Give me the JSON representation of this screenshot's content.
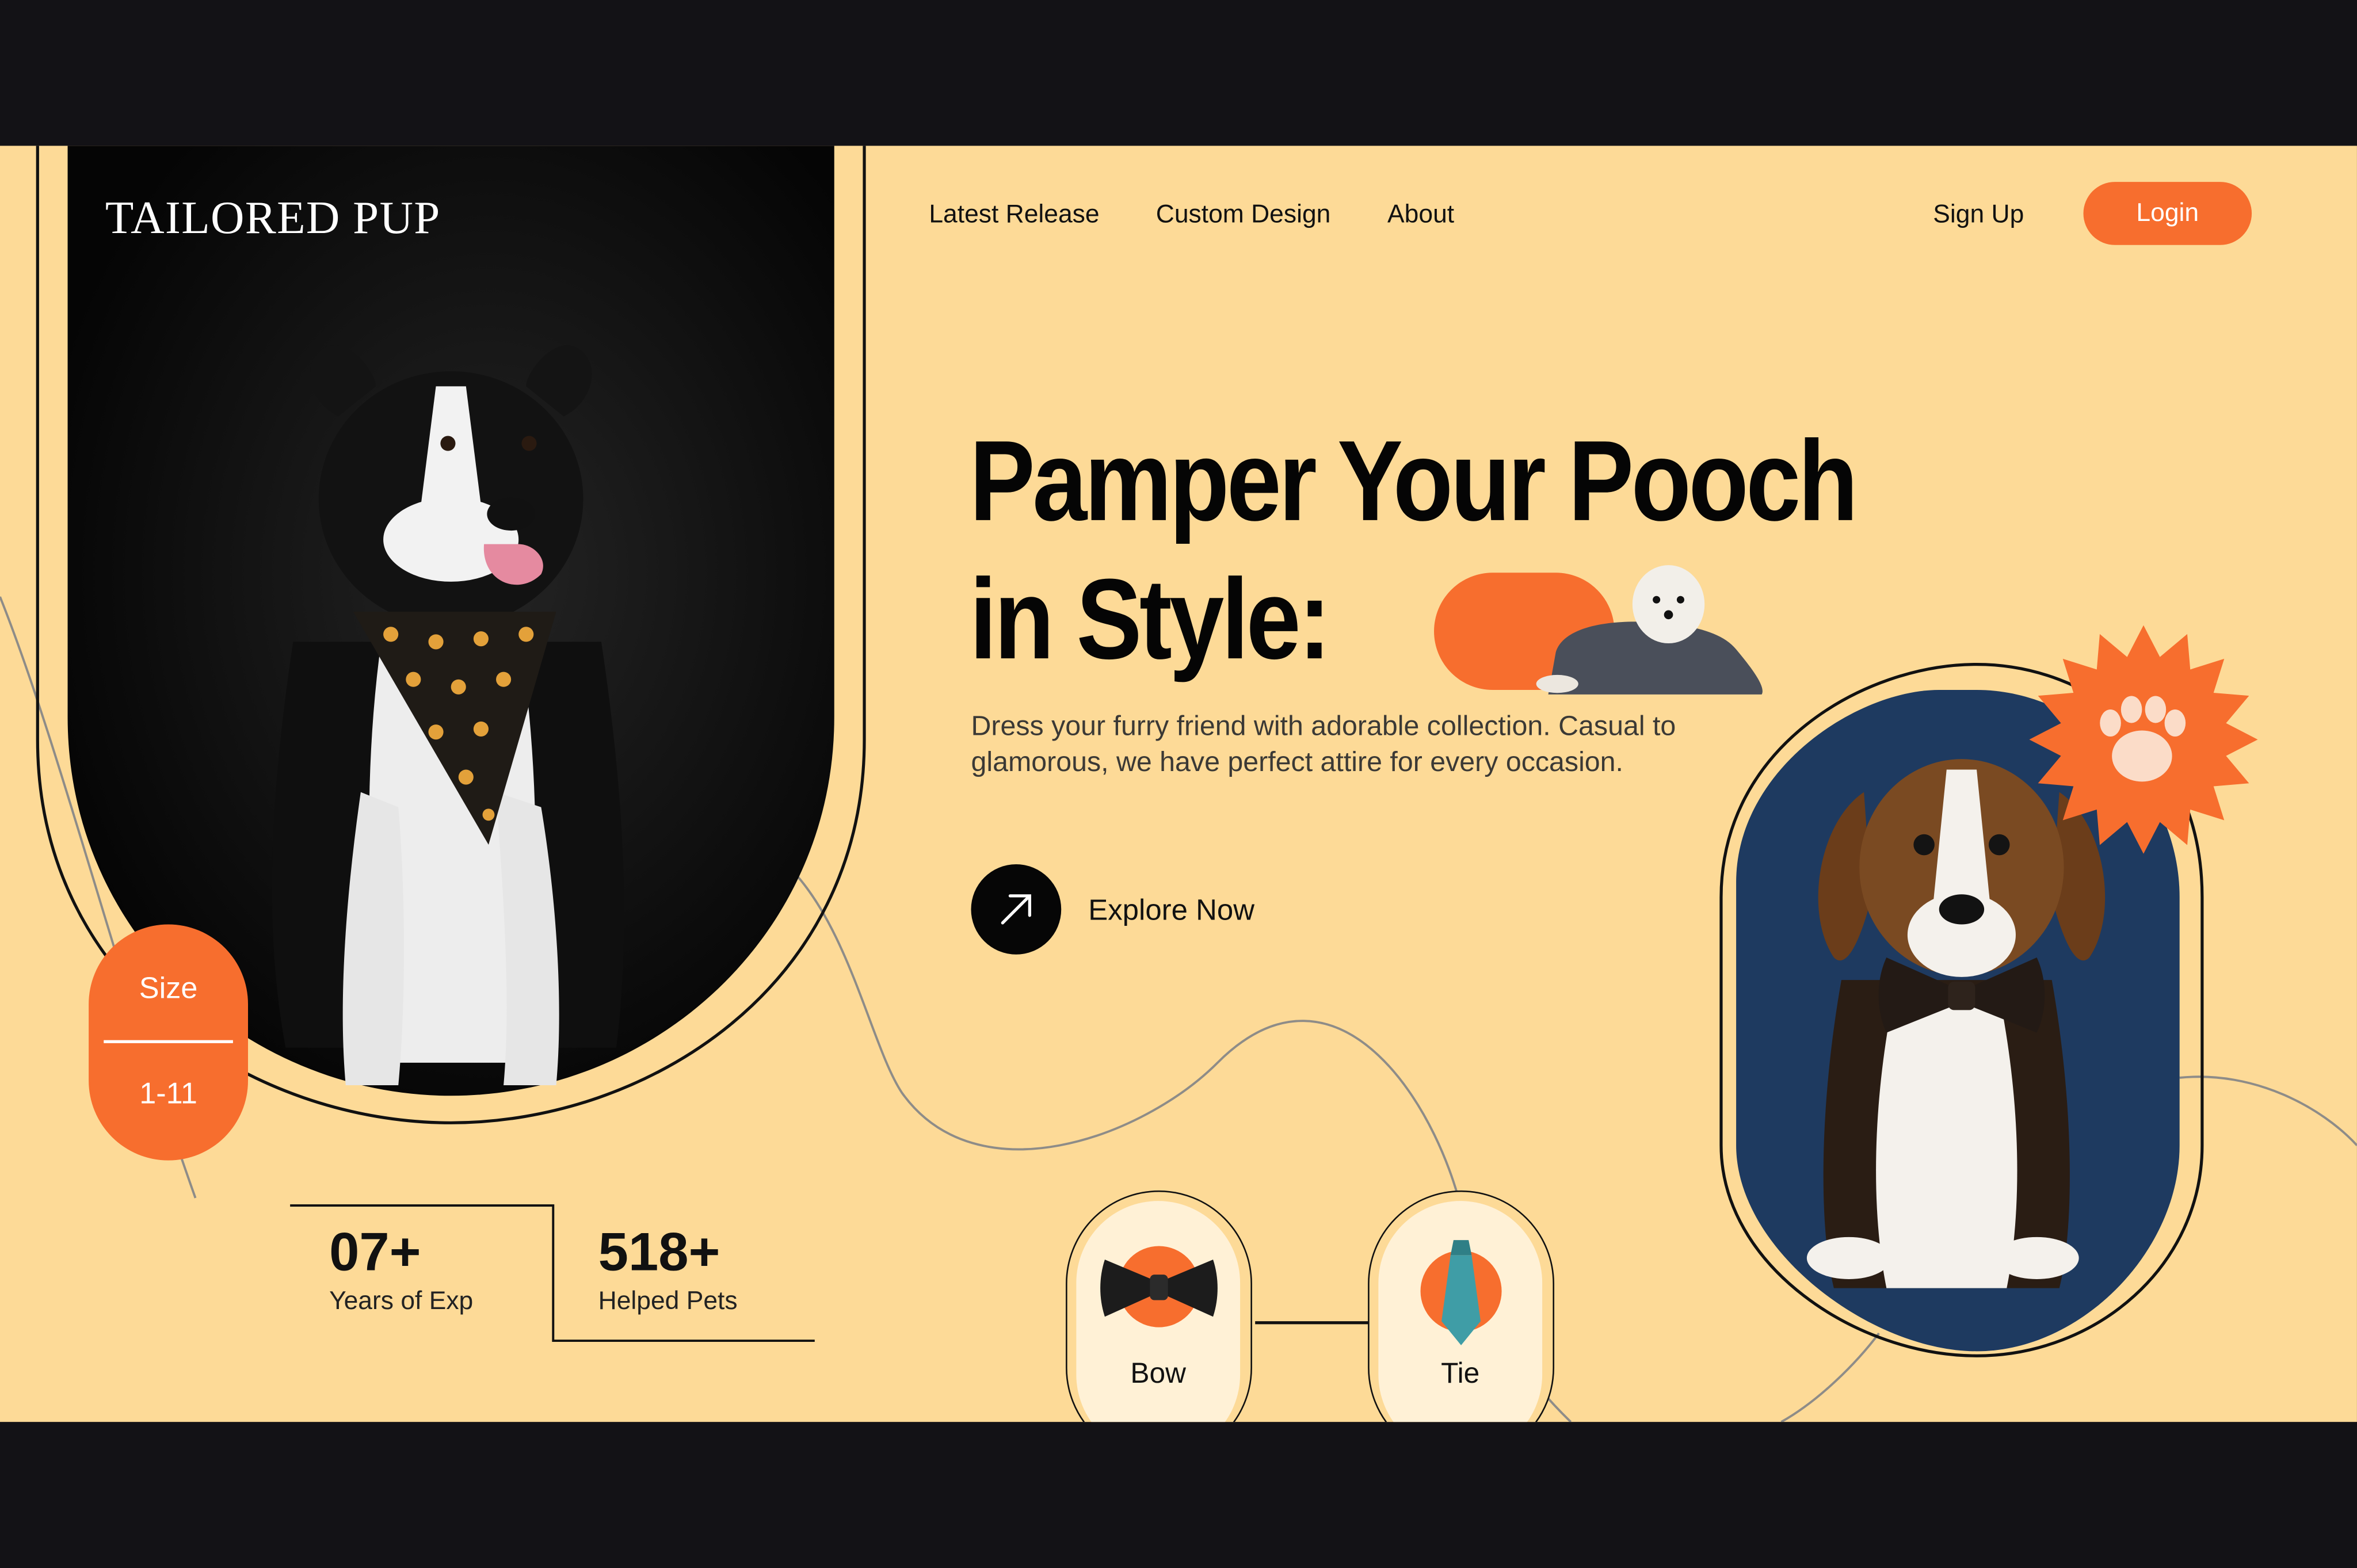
{
  "brand": {
    "logo": "TAILORED PUP"
  },
  "nav": {
    "items": [
      "Latest Release",
      "Custom Design",
      "About"
    ],
    "signup": "Sign Up",
    "login": "Login"
  },
  "hero": {
    "title_line1": "Pamper Your Pooch",
    "title_line2": "in Style:",
    "description": "Dress your furry friend with adorable collection. Casual to glamorous, we have  perfect attire for every occasion.",
    "cta": "Explore Now"
  },
  "size_badge": {
    "label": "Size",
    "value": "1-11"
  },
  "stats": [
    {
      "value": "07+",
      "label": "Years of Exp"
    },
    {
      "value": "518+",
      "label": "Helped Pets"
    }
  ],
  "accessories": [
    {
      "label": "Bow",
      "icon": "bow-tie-icon"
    },
    {
      "label": "Tie",
      "icon": "necktie-icon"
    }
  ],
  "colors": {
    "background": "#fdda97",
    "accent": "#f76e2e",
    "dark": "#060606",
    "navy": "#1e3a60",
    "frame": "#131216"
  },
  "icons": {
    "cta": "arrow-up-right-icon",
    "badge": "paw-icon"
  }
}
